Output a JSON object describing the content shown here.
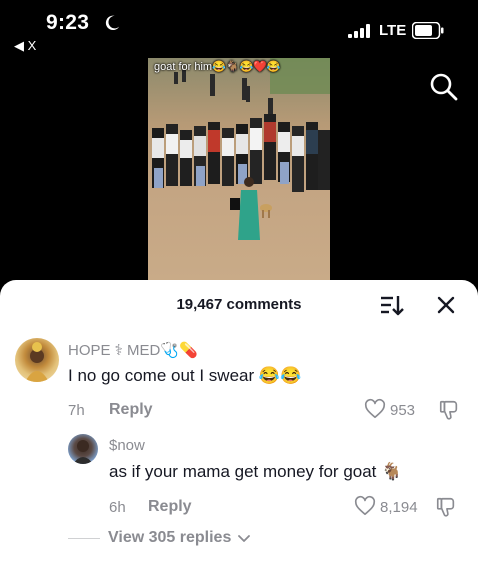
{
  "status_bar": {
    "time": "9:23",
    "back_label": "◀ X",
    "network": "LTE"
  },
  "video": {
    "caption": "goat for him😂🐐😂❤️😂"
  },
  "comments_sheet": {
    "title": "19,467 comments",
    "comments": [
      {
        "username": "HOPE ⚕ MED🩺💊",
        "text": "I no go come out I swear 😂😂",
        "time": "7h",
        "reply_label": "Reply",
        "likes": "953"
      }
    ],
    "replies": [
      {
        "username": "$now",
        "text": "as if your mama get money for goat 🐐",
        "time": "6h",
        "reply_label": "Reply",
        "likes": "8,194"
      }
    ],
    "view_replies_label": "View 305 replies"
  },
  "colors": {
    "accent_text": "#161823",
    "muted_text": "#8a8b91",
    "sheet_bg": "#ffffff",
    "screen_bg": "#000000"
  }
}
